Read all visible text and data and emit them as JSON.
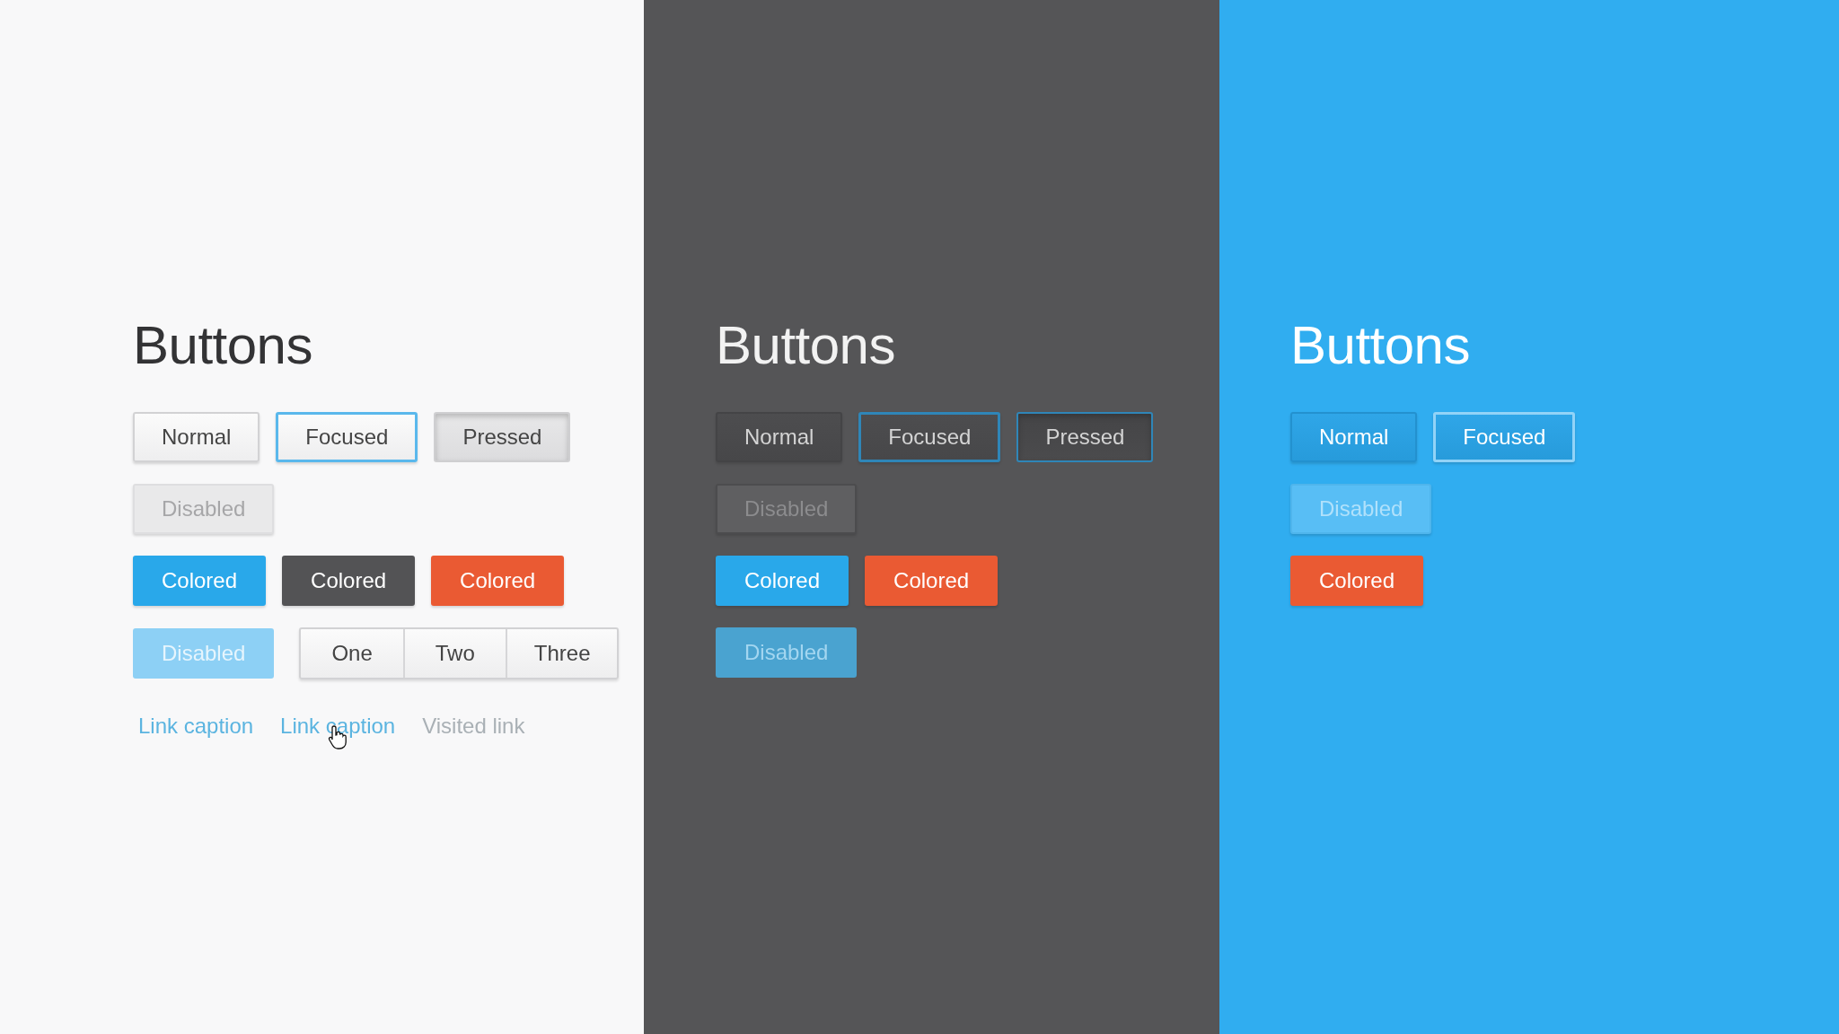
{
  "panels": [
    {
      "kind": "light",
      "title": "Buttons",
      "rows": [
        {
          "items": [
            {
              "kind": "button",
              "label": "Normal",
              "focused": false,
              "pressed": false,
              "disabled": false
            },
            {
              "kind": "button",
              "label": "Focused",
              "focused": true,
              "pressed": false,
              "disabled": false
            },
            {
              "kind": "button",
              "label": "Pressed",
              "focused": false,
              "pressed": true,
              "disabled": false
            }
          ]
        },
        {
          "items": [
            {
              "kind": "button",
              "label": "Disabled",
              "focused": false,
              "pressed": false,
              "disabled": true
            }
          ]
        },
        {
          "items": [
            {
              "kind": "button",
              "label": "Colored",
              "focused": false,
              "pressed": false,
              "disabled": false,
              "color": "#29a8ea"
            },
            {
              "kind": "button",
              "label": "Colored",
              "focused": false,
              "pressed": false,
              "disabled": false,
              "color": "#535355"
            },
            {
              "kind": "button",
              "label": "Colored",
              "focused": false,
              "pressed": false,
              "disabled": false,
              "color": "#ea5a33"
            }
          ]
        },
        {
          "items": [
            {
              "kind": "button",
              "label": "Disabled",
              "focused": false,
              "pressed": false,
              "disabled": true,
              "color": "#8dd0f5"
            },
            {
              "kind": "segmented",
              "segments": [
                {
                  "label": "One"
                },
                {
                  "label": "Two"
                },
                {
                  "label": "Three"
                }
              ]
            }
          ]
        },
        {
          "items": [
            {
              "kind": "link",
              "label": "Link caption",
              "visited": false
            },
            {
              "kind": "link",
              "label": "Link caption",
              "visited": false
            },
            {
              "kind": "link",
              "label": "Visited link",
              "visited": true
            }
          ]
        }
      ]
    },
    {
      "kind": "dark",
      "title": "Buttons",
      "rows": [
        {
          "items": [
            {
              "kind": "button",
              "label": "Normal",
              "focused": false,
              "pressed": false,
              "disabled": false
            },
            {
              "kind": "button",
              "label": "Focused",
              "focused": true,
              "pressed": false,
              "disabled": false
            },
            {
              "kind": "button",
              "label": "Pressed",
              "focused": false,
              "pressed": true,
              "disabled": false
            }
          ]
        },
        {
          "items": [
            {
              "kind": "button",
              "label": "Disabled",
              "focused": false,
              "pressed": false,
              "disabled": true
            }
          ]
        },
        {
          "items": [
            {
              "kind": "button",
              "label": "Colored",
              "focused": false,
              "pressed": false,
              "disabled": false,
              "color": "#29a8ea"
            },
            {
              "kind": "button",
              "label": "Colored",
              "focused": false,
              "pressed": false,
              "disabled": false,
              "color": "#ea5a33"
            }
          ]
        },
        {
          "items": [
            {
              "kind": "button",
              "label": "Disabled",
              "focused": false,
              "pressed": false,
              "disabled": true,
              "color": "#4aa3d0"
            }
          ]
        }
      ]
    },
    {
      "kind": "blue",
      "title": "Buttons",
      "rows": [
        {
          "items": [
            {
              "kind": "button",
              "label": "Normal",
              "focused": false,
              "pressed": false,
              "disabled": false
            },
            {
              "kind": "button",
              "label": "Focused",
              "focused": true,
              "pressed": false,
              "disabled": false
            }
          ]
        },
        {
          "items": [
            {
              "kind": "button",
              "label": "Disabled",
              "focused": false,
              "pressed": false,
              "disabled": true
            }
          ]
        },
        {
          "items": [
            {
              "kind": "button",
              "label": "Colored",
              "focused": false,
              "pressed": false,
              "disabled": false,
              "color": "#ea5a33"
            }
          ]
        }
      ]
    }
  ]
}
